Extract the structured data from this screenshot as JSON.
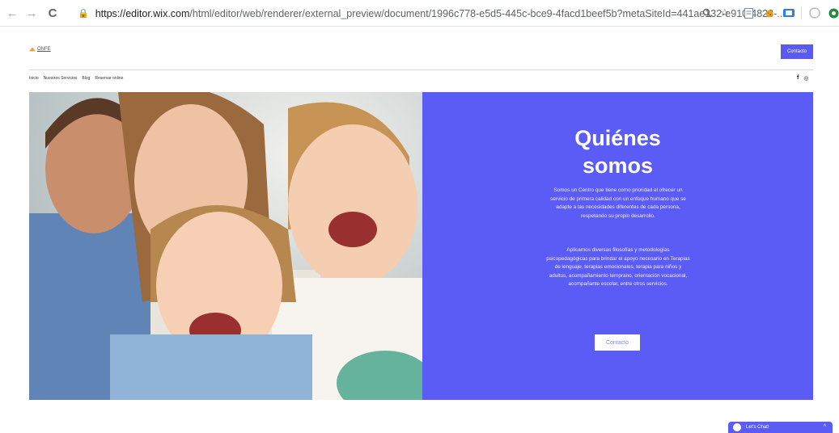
{
  "browser": {
    "url_lock": "🔒",
    "url_host": "https://editor.wix.com",
    "url_path": "/html/editor/web/renderer/external_preview/document/1996c778-e5d5-445c-bce9-4facd1beef5b?metaSiteId=441ae132-e910-4823-...",
    "back": "←",
    "forward": "→",
    "reload": "C"
  },
  "site": {
    "logo_text": "ONFE",
    "header_button": "Contacto",
    "menu": [
      "Inicio",
      "Nuestros Servicios",
      "Blog",
      "Reservar online"
    ],
    "social": [
      "f",
      "◎"
    ]
  },
  "hero": {
    "title_line1": "Quiénes",
    "title_line2": "somos",
    "paragraph1": "Somos un Centro  que tiene como prioridad el ofrecer un servicio de primera calidad con un enfoque humano que se adapte a las necesidades diferentes de cada persona, respetando su propio desarrollo.",
    "paragraph2": "Aplicamos diversas filosofías y metodologías psicopedagógicas para brindar el apoyo necesario en Terapias de lenguaje, terapias emocionales, terapia para niños y adultos, acompañamiento temprano, orientación vocacional, acompañante escolar, entre otros servicios.",
    "button": "Contacto"
  },
  "chat": {
    "label": "Let's Chat!",
    "chevron": "^"
  },
  "colors": {
    "accent": "#5b5bf5"
  }
}
